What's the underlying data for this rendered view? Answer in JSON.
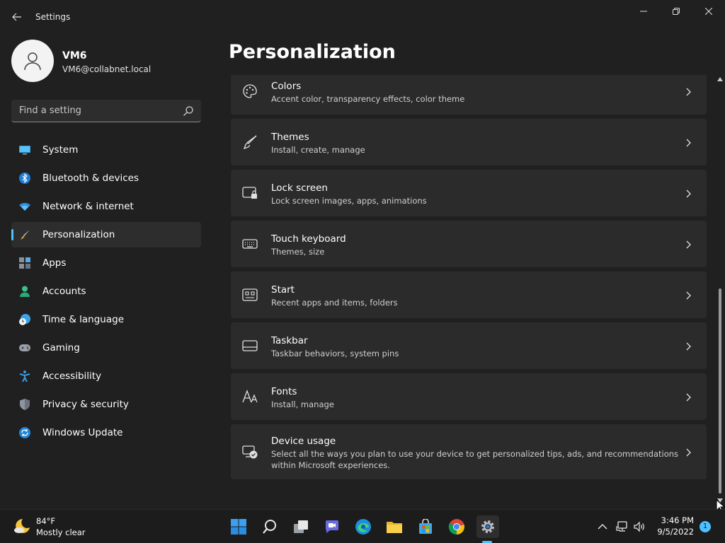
{
  "window": {
    "title": "Settings"
  },
  "profile": {
    "name": "VM6",
    "email": "VM6@collabnet.local"
  },
  "search": {
    "placeholder": "Find a setting"
  },
  "sidebar": {
    "items": [
      {
        "label": "System",
        "icon": "monitor-icon"
      },
      {
        "label": "Bluetooth & devices",
        "icon": "bluetooth-icon"
      },
      {
        "label": "Network & internet",
        "icon": "wifi-icon"
      },
      {
        "label": "Personalization",
        "icon": "brush-icon",
        "selected": true
      },
      {
        "label": "Apps",
        "icon": "apps-icon"
      },
      {
        "label": "Accounts",
        "icon": "person-icon"
      },
      {
        "label": "Time & language",
        "icon": "clock-globe-icon"
      },
      {
        "label": "Gaming",
        "icon": "gamepad-icon"
      },
      {
        "label": "Accessibility",
        "icon": "accessibility-icon"
      },
      {
        "label": "Privacy & security",
        "icon": "shield-icon"
      },
      {
        "label": "Windows Update",
        "icon": "update-icon"
      }
    ]
  },
  "main": {
    "title": "Personalization",
    "cards": [
      {
        "title": "Colors",
        "subtitle": "Accent color, transparency effects, color theme",
        "icon": "palette-icon"
      },
      {
        "title": "Themes",
        "subtitle": "Install, create, manage",
        "icon": "brush-icon"
      },
      {
        "title": "Lock screen",
        "subtitle": "Lock screen images, apps, animations",
        "icon": "lock-screen-icon"
      },
      {
        "title": "Touch keyboard",
        "subtitle": "Themes, size",
        "icon": "keyboard-icon"
      },
      {
        "title": "Start",
        "subtitle": "Recent apps and items, folders",
        "icon": "start-icon"
      },
      {
        "title": "Taskbar",
        "subtitle": "Taskbar behaviors, system pins",
        "icon": "taskbar-icon"
      },
      {
        "title": "Fonts",
        "subtitle": "Install, manage",
        "icon": "fonts-icon"
      },
      {
        "title": "Device usage",
        "subtitle": "Select all the ways you plan to use your device to get personalized tips, ads, and recommendations within Microsoft experiences.",
        "icon": "device-usage-icon"
      }
    ]
  },
  "taskbar": {
    "weather_temp": "84°F",
    "weather_condition": "Mostly clear",
    "time": "3:46 PM",
    "date": "9/5/2022",
    "notification_count": "1",
    "apps": [
      "windows-start-icon",
      "search-icon",
      "task-view-icon",
      "chat-icon",
      "edge-icon",
      "file-explorer-icon",
      "store-icon",
      "chrome-icon",
      "settings-icon"
    ]
  },
  "colors": {
    "accent": "#4cc2ff",
    "background": "#202020",
    "card": "#2b2b2b"
  }
}
